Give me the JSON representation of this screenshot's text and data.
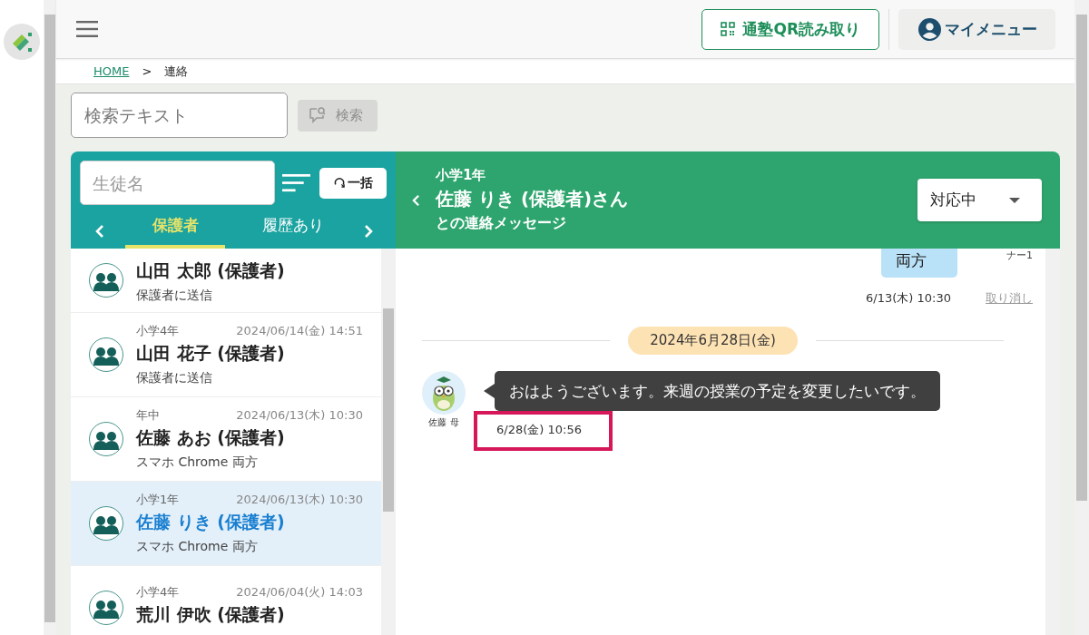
{
  "header": {
    "qr_button": "通塾QR読み取り",
    "menu_button": "マイメニュー"
  },
  "breadcrumb": [
    {
      "label": "HOME",
      "kind": "link"
    },
    {
      "label": ">",
      "kind": "separator"
    },
    {
      "label": "連絡",
      "kind": "current"
    }
  ],
  "search": {
    "placeholder": "検索テキスト",
    "button": "検索",
    "disabled": true
  },
  "student_panel": {
    "name_placeholder": "生徒名",
    "bulk_button": "一括",
    "tabs": [
      {
        "label": "保護者",
        "selected": true
      },
      {
        "label": "履歴あり",
        "selected": false
      }
    ]
  },
  "contacts": [
    {
      "name": "山田 太郎 (保護者)",
      "status": "保護者に送信",
      "selected": false
    },
    {
      "grade": "小学4年",
      "date": "2024/06/14(金) 14:51",
      "name": "山田 花子 (保護者)",
      "status": "保護者に送信",
      "selected": false
    },
    {
      "grade": "年中",
      "date": "2024/06/13(木) 10:30",
      "name": "佐藤 あお (保護者)",
      "status": "スマホ Chrome 両方",
      "selected": false
    },
    {
      "grade": "小学1年",
      "date": "2024/06/13(木) 10:30",
      "name": "佐藤 りき (保護者)",
      "status": "スマホ Chrome 両方",
      "selected": true
    },
    {
      "grade": "小学4年",
      "date": "2024/06/04(火) 14:03",
      "name": "荒川 伊吹 (保護者)",
      "selected": false
    }
  ],
  "conversation": {
    "grade": "小学1年",
    "title": "佐藤 りき (保護者)さん",
    "subtitle": "との連絡メッセージ",
    "status": "対応中"
  },
  "messages": [
    {
      "kind": "outgoing",
      "text": "両方",
      "read_label": "ナー1",
      "time": "6/13(木) 10:30",
      "cancel": "取り消し"
    },
    {
      "kind": "date",
      "text": "2024年6月28日(金)"
    },
    {
      "kind": "incoming",
      "sender": "佐藤 母",
      "text": "おはようございます。来週の授業の予定を変更したいです。",
      "time": "6/28(金) 10:56",
      "highlighted": true
    }
  ]
}
